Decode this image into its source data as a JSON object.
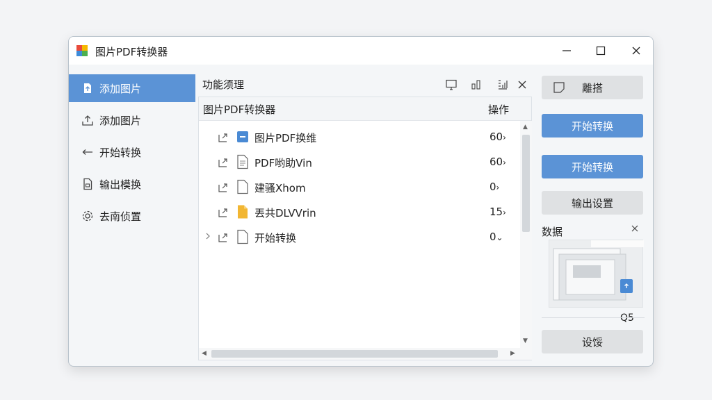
{
  "window": {
    "title": "图片PDF转换器"
  },
  "sidebar": {
    "items": [
      {
        "label": "添加图片",
        "icon": "upload-arrow-icon",
        "active": true
      },
      {
        "label": "添加图片",
        "icon": "upload-icon",
        "active": false
      },
      {
        "label": "开始转换",
        "icon": "arrow-left-icon",
        "active": false
      },
      {
        "label": "输出模换",
        "icon": "document-icon",
        "active": false
      },
      {
        "label": "去南侦置",
        "icon": "gear-icon",
        "active": false
      }
    ]
  },
  "main": {
    "title": "功能须理",
    "toolbar_icons": [
      "monitor-icon",
      "bar-chart-icon",
      "grid-icon",
      "close-icon"
    ],
    "table": {
      "headers": {
        "name": "图片PDF转换器",
        "operation": "操作"
      },
      "rows": [
        {
          "name": "图片PDF换维",
          "value": "60",
          "indicator": "›",
          "file_icon": "image-file-icon",
          "expandable": false
        },
        {
          "name": "PDF哟助Vin",
          "value": "60",
          "indicator": "›",
          "file_icon": "document-icon",
          "expandable": false
        },
        {
          "name": "建骚Xhom",
          "value": "0",
          "indicator": "›",
          "file_icon": "blank-file-icon",
          "expandable": false
        },
        {
          "name": "丟共DLVVrin",
          "value": "15",
          "indicator": "›",
          "file_icon": "folder-file-icon",
          "expandable": false
        },
        {
          "name": "开始转换",
          "value": "0",
          "indicator": "⌄",
          "file_icon": "blank-file-icon",
          "expandable": true
        }
      ]
    }
  },
  "right_panel": {
    "buttons": [
      {
        "label": "離搭",
        "style": "gray",
        "icon": "note-icon"
      },
      {
        "label": "开始转换",
        "style": "blue"
      },
      {
        "label": "开始转换",
        "style": "blue"
      },
      {
        "label": "输出设置",
        "style": "gray"
      }
    ],
    "preview": {
      "label": "数据",
      "count": "Q5"
    },
    "bottom_button": "设馁"
  },
  "colors": {
    "accent": "#5b93d6",
    "background": "#f4f6f8",
    "button_gray": "#dfe1e3"
  }
}
